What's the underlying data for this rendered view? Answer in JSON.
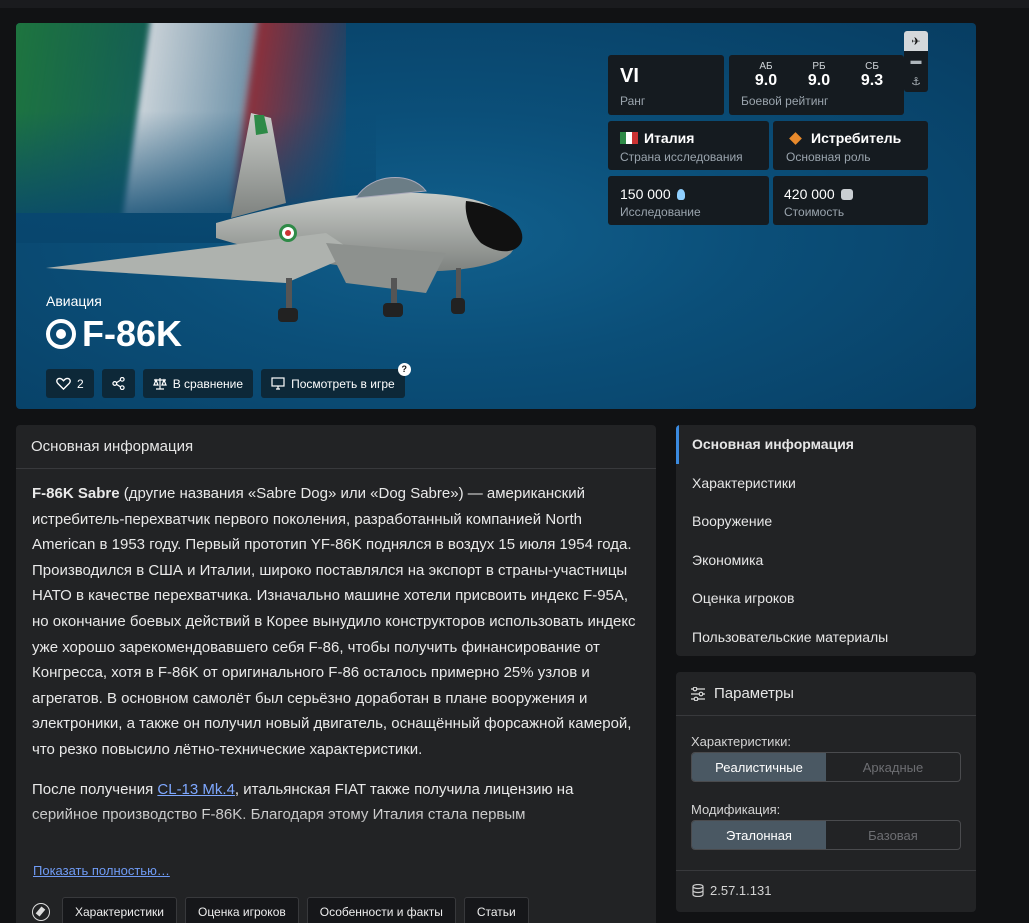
{
  "hero": {
    "category": "Авиация",
    "title": "F-86K",
    "actions": {
      "likes": "2",
      "compare": "В сравнение",
      "view_ingame": "Посмотреть в игре",
      "help": "?"
    },
    "rank": {
      "value": "VI",
      "label": "Ранг"
    },
    "battle_rating": {
      "label": "Боевой рейтинг",
      "ab_label": "АБ",
      "ab": "9.0",
      "rb_label": "РБ",
      "rb": "9.0",
      "sb_label": "СБ",
      "sb": "9.3"
    },
    "country": {
      "value": "Италия",
      "label": "Страна исследования"
    },
    "role": {
      "value": "Истребитель",
      "label": "Основная роль"
    },
    "research": {
      "value": "150 000",
      "label": "Исследование"
    },
    "cost": {
      "value": "420 000",
      "label": "Стоимость"
    }
  },
  "info": {
    "heading": "Основная информация",
    "p1_bold": "F-86K Sabre",
    "p1_text": " (другие названия «Sabre Dog» или «Dog Sabre») — американский истребитель-перехватчик первого поколения, разработанный компанией North American в 1953 году. Первый прототип YF-86K поднялся в воздух 15 июля 1954 года. Производился в США и Италии, широко поставлялся на экспорт в страны-участницы НАТО в качестве перехватчика. Изначально машине хотели присвоить индекс F-95A, но окончание боевых действий в Корее вынудило конструкторов использовать индекс уже хорошо зарекомендовавшего себя F-86, чтобы получить финансирование от Конгресса, хотя в F-86K от оригинального F-86 осталось примерно 25% узлов и агрегатов. В основном самолёт был серьёзно доработан в плане вооружения и электроники, а также он получил новый двигатель, оснащённый форсажной камерой, что резко повысило лётно-технические характеристики.",
    "p2_pre": "После получения ",
    "p2_link": "CL-13 Mk.4",
    "p2_post": ", итальянская FIAT также получила лицензию на серийное производство F-86K. Благодаря этому Италия стала первым",
    "show_more": "Показать полностью…",
    "tags": [
      "Характеристики",
      "Оценка игроков",
      "Особенности и факты",
      "Статьи"
    ]
  },
  "nav": {
    "items": [
      "Основная информация",
      "Характеристики",
      "Вооружение",
      "Экономика",
      "Оценка игроков",
      "Пользовательские материалы"
    ]
  },
  "params": {
    "heading": "Параметры",
    "char_label": "Характеристики:",
    "char_options": [
      "Реалистичные",
      "Аркадные"
    ],
    "mod_label": "Модификация:",
    "mod_options": [
      "Эталонная",
      "Базовая"
    ],
    "version": "2.57.1.131"
  }
}
